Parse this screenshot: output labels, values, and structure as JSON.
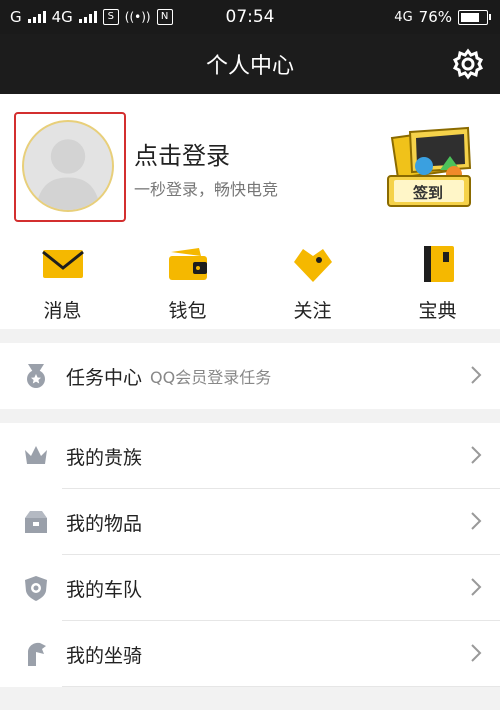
{
  "status_bar": {
    "left_text": "G",
    "network_label": "4G",
    "time": "07:54",
    "network_right": "4G",
    "battery_level": 76,
    "battery_label": "76%"
  },
  "header": {
    "title": "个人中心"
  },
  "profile": {
    "login_title": "点击登录",
    "login_subtitle": "一秒登录，畅快电竞",
    "signin_label": "签到"
  },
  "quick_actions": [
    {
      "label": "消息",
      "icon": "envelope-icon"
    },
    {
      "label": "钱包",
      "icon": "wallet-icon"
    },
    {
      "label": "关注",
      "icon": "heart-tag-icon"
    },
    {
      "label": "宝典",
      "icon": "book-icon"
    }
  ],
  "task_center": {
    "label": "任务中心",
    "subtitle": "QQ会员登录任务"
  },
  "menu": [
    {
      "label": "我的贵族",
      "icon": "crown-icon"
    },
    {
      "label": "我的物品",
      "icon": "box-icon"
    },
    {
      "label": "我的车队",
      "icon": "team-shield-icon"
    },
    {
      "label": "我的坐骑",
      "icon": "mount-icon"
    }
  ],
  "colors": {
    "accent": "#f5b800",
    "header_bg": "#1c1c1c",
    "highlight_border": "#d32f2f",
    "icon_gray": "#9aa0aa"
  }
}
